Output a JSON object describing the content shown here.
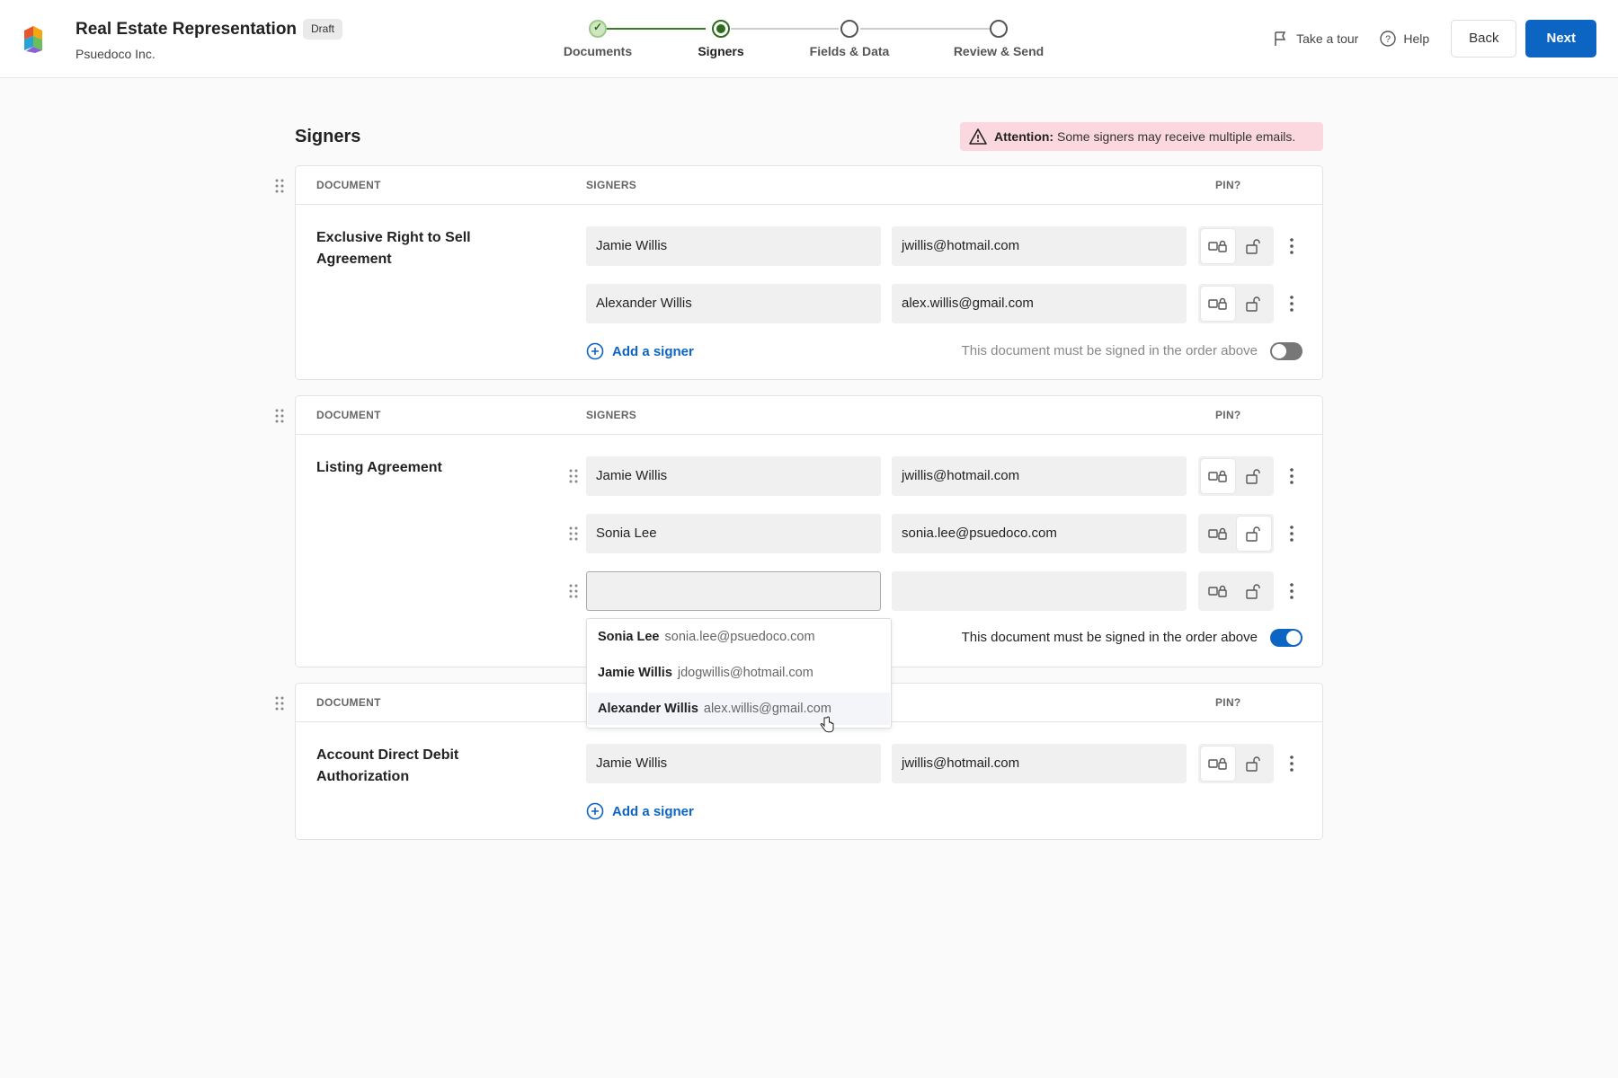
{
  "header": {
    "title": "Real Estate Representation",
    "status_badge": "Draft",
    "company": "Psuedoco Inc.",
    "steps": [
      {
        "label": "Documents",
        "state": "done"
      },
      {
        "label": "Signers",
        "state": "current"
      },
      {
        "label": "Fields & Data",
        "state": "pending"
      },
      {
        "label": "Review & Send",
        "state": "pending"
      }
    ],
    "tour_label": "Take a tour",
    "help_label": "Help",
    "back_label": "Back",
    "next_label": "Next"
  },
  "page": {
    "title": "Signers",
    "attention_label": "Attention:",
    "attention_text": "Some signers may receive multiple emails."
  },
  "columns": {
    "document": "DOCUMENT",
    "signers": "SIGNERS",
    "pin": "PIN?"
  },
  "documents": [
    {
      "name": "Exclusive Right to Sell Agreement",
      "signers": [
        {
          "name": "Jamie Willis",
          "email": "jwillis@hotmail.com"
        },
        {
          "name": "Alexander Willis",
          "email": "alex.willis@gmail.com"
        }
      ],
      "add_signer": "Add a signer",
      "order_text": "This document must be signed in the order above",
      "order_enabled": false
    },
    {
      "name": "Listing Agreement",
      "signers": [
        {
          "name": "Jamie Willis",
          "email": "jwillis@hotmail.com"
        },
        {
          "name": "Sonia Lee",
          "email": "sonia.lee@psuedoco.com"
        },
        {
          "name": "",
          "email": ""
        }
      ],
      "order_text": "This document must be signed in the order above",
      "order_enabled": true
    },
    {
      "name": "Account Direct Debit Authorization",
      "signers": [
        {
          "name": "Jamie Willis",
          "email": "jwillis@hotmail.com"
        }
      ],
      "add_signer": "Add a signer"
    }
  ],
  "suggestions": [
    {
      "name": "Sonia Lee",
      "email": "sonia.lee@psuedoco.com"
    },
    {
      "name": "Jamie Willis",
      "email": "jdogwillis@hotmail.com"
    },
    {
      "name": "Alexander Willis",
      "email": "alex.willis@gmail.com"
    }
  ],
  "colors": {
    "primary": "#0c65c2",
    "step_done": "#3c7a24",
    "attention_bg": "#fbd7e0"
  }
}
